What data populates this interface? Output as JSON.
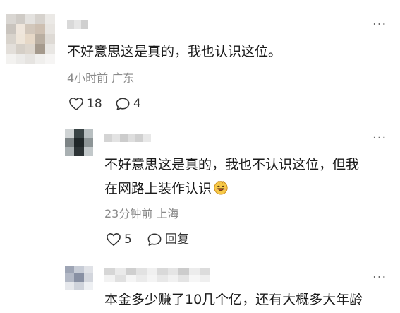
{
  "comments": [
    {
      "more": "···",
      "text": "不好意思这是真的，我也认识这位。",
      "meta": "4小时前 广东",
      "likes": "18",
      "replies": "4"
    },
    {
      "more": "···",
      "text_line1": "不好意思这是真的，我也不认识这位，但我",
      "text_line2": "在网路上装作认识",
      "meta": "23分钟前 上海",
      "likes": "5",
      "reply_label": "回复"
    },
    {
      "more": "···",
      "text": "本金多少赚了10几个亿，还有大概多大年龄"
    }
  ],
  "icons": {
    "like": "heart-outline-icon",
    "reply": "speech-bubble-icon",
    "emoji": "laughing-face-emoji-icon"
  }
}
